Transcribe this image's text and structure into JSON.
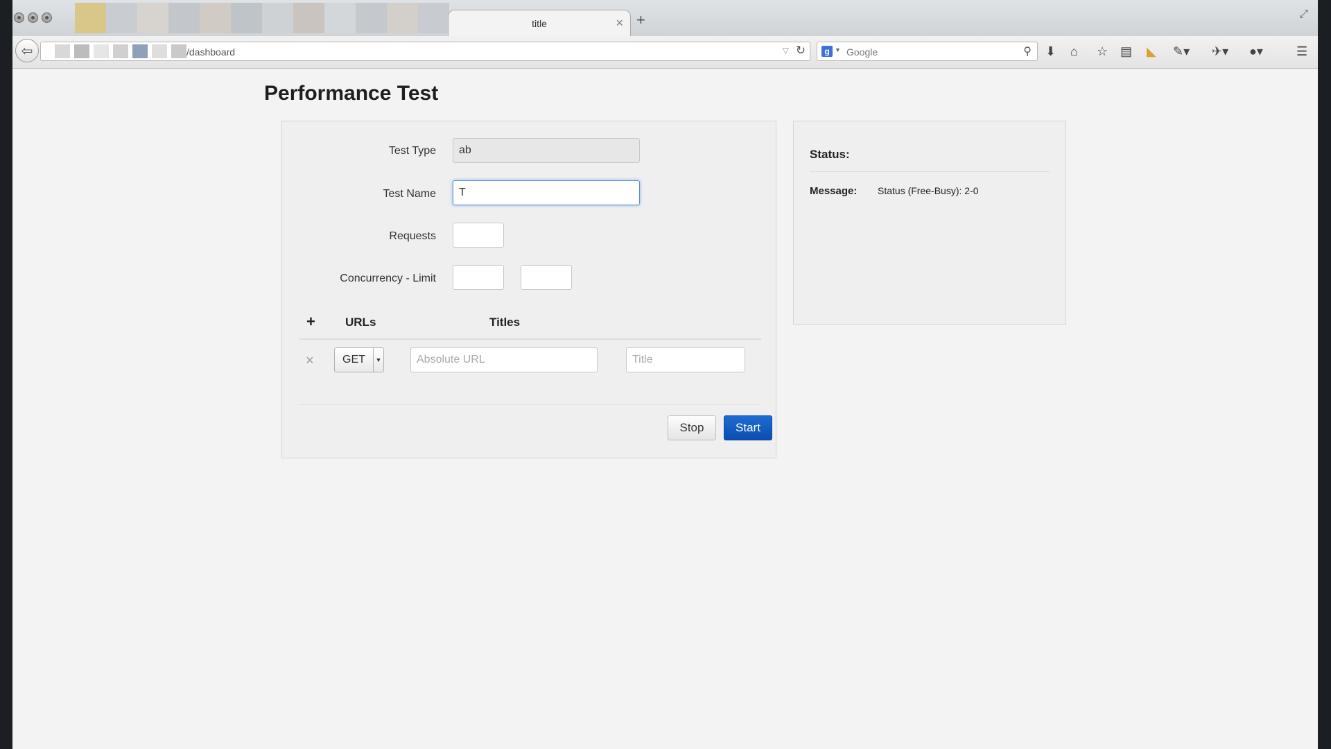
{
  "browser": {
    "tab": {
      "title": "title",
      "close_glyph": "×"
    },
    "new_tab_glyph": "+",
    "url": "/dashboard",
    "search": {
      "engine_icon": "google-icon",
      "engine_letter": "g",
      "placeholder": "Google"
    }
  },
  "page": {
    "title": "Performance Test",
    "form": {
      "test_type": {
        "label": "Test Type",
        "value": "ab"
      },
      "test_name": {
        "label": "Test Name",
        "value": "T"
      },
      "requests": {
        "label": "Requests",
        "value": ""
      },
      "concurrency_limit": {
        "label": "Concurrency - Limit",
        "concurrency_value": "",
        "limit_value": ""
      },
      "urls_section": {
        "add_glyph": "+",
        "urls_header": "URLs",
        "titles_header": "Titles",
        "rows": [
          {
            "remove_glyph": "×",
            "method": "GET",
            "url_placeholder": "Absolute URL",
            "title_placeholder": "Title"
          }
        ]
      },
      "buttons": {
        "stop": "Stop",
        "start": "Start"
      }
    },
    "status": {
      "title": "Status:",
      "message_label": "Message:",
      "message_value": "Status (Free-Busy): 2-0"
    }
  },
  "colors": {
    "primary_button": "#0b4fb0",
    "focus_ring": "#5a8fd6",
    "page_background": "#f3f3f3"
  }
}
